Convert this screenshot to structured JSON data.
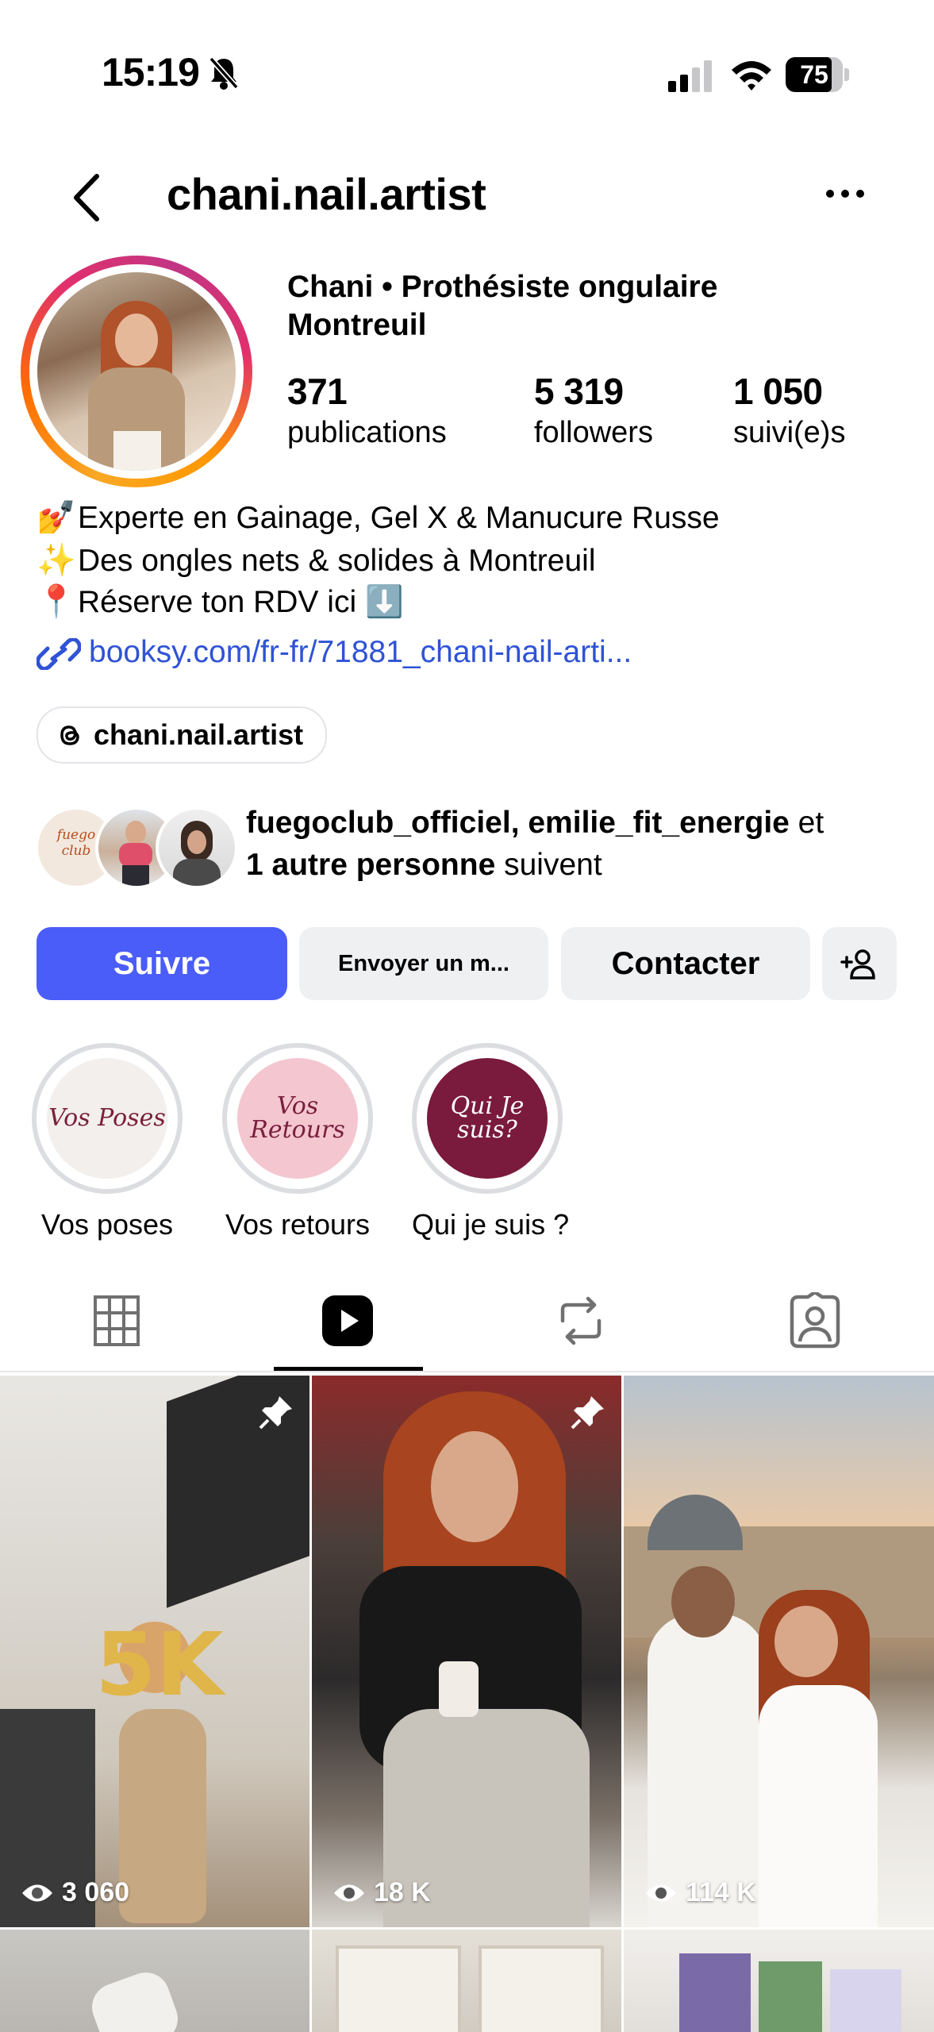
{
  "status_bar": {
    "time": "15:19",
    "battery": "75"
  },
  "header": {
    "username": "chani.nail.artist"
  },
  "profile": {
    "name": "Chani • Prothésiste ongulaire Montreuil",
    "stats": [
      {
        "value": "371",
        "label": "publications"
      },
      {
        "value": "5 319",
        "label": "followers"
      },
      {
        "value": "1 050",
        "label": "suivi(e)s"
      }
    ],
    "bio": [
      {
        "emoji": "💅",
        "text": "Experte en Gainage, Gel X & Manucure Russe"
      },
      {
        "emoji": "✨",
        "text": "Des ongles nets & solides à Montreuil"
      },
      {
        "emoji": "📍",
        "text": "Réserve ton RDV ici ⬇️"
      }
    ],
    "link": "booksy.com/fr-fr/71881_chani-nail-arti...",
    "threads": "chani.nail.artist"
  },
  "followed_by": {
    "names": "fuegoclub_officiel, emilie_fit_energie",
    "et": " et",
    "others": "1 autre personne",
    "suffix": " suivent",
    "avatar1_text": "fuego club"
  },
  "buttons": {
    "follow": "Suivre",
    "message": "Envoyer un m...",
    "contact": "Contacter"
  },
  "highlights": [
    {
      "label": "Vos poses",
      "cover_text": "Vos Poses",
      "bg": "#f3efec",
      "fg": "#7a1f3d"
    },
    {
      "label": "Vos retours",
      "cover_text": "Vos Retours",
      "bg": "#f4c6d0",
      "fg": "#7a1f3d"
    },
    {
      "label": "Qui je suis ?",
      "cover_text": "Qui Je suis?",
      "bg": "#7a1a3c",
      "fg": "#ffffff"
    }
  ],
  "tabs": [
    "grid-tab",
    "reels-tab",
    "reposts-tab",
    "tagged-tab"
  ],
  "active_tab": "reels-tab",
  "posts": [
    {
      "views": "3 060",
      "pinned": true
    },
    {
      "views": "18 K",
      "pinned": true
    },
    {
      "views": "114 K",
      "pinned": false
    }
  ],
  "colors": {
    "accent": "#4a5df9",
    "link": "#2f53d6"
  }
}
